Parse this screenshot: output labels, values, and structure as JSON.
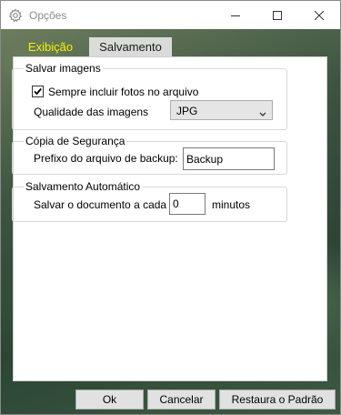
{
  "window": {
    "title": "Opções",
    "icon": "gear-icon",
    "controls": [
      "minimize-icon",
      "maximize-icon",
      "close-icon"
    ]
  },
  "tabs": [
    {
      "label": "Exibição",
      "active": true,
      "color": "#f2f200"
    },
    {
      "label": "Salvamento",
      "active": false
    }
  ],
  "save_images": {
    "title": "Salvar imagens",
    "always_include_label": "Sempre incluir fotos no arquivo",
    "always_include_checked": true,
    "quality_label": "Qualidade das imagens",
    "quality_value": "JPG"
  },
  "backup": {
    "title": "Cópia de Segurança",
    "prefix_label": "Prefixo do arquivo de backup:",
    "prefix_value": "Backup"
  },
  "autosave": {
    "title": "Salvamento Automático",
    "every_label": "Salvar o documento a cada",
    "minutes_value": "0",
    "unit_label": "minutos"
  },
  "buttons": {
    "ok": "Ok",
    "cancel": "Cancelar",
    "restore": "Restaura o Padrão"
  }
}
